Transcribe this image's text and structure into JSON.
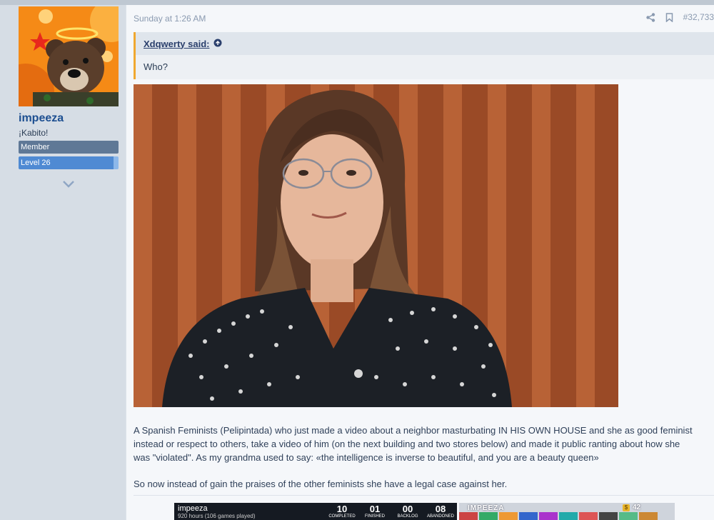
{
  "user": {
    "name": "impeeza",
    "title": "¡Kabito!",
    "banner_member": "Member",
    "banner_level": "Level 26"
  },
  "post": {
    "date": "Sunday at 1:26 AM",
    "number": "#32,733",
    "quote": {
      "author": "Xdqwerty said:",
      "text": "Who?"
    },
    "paragraph1": [
      "A Spanish Feminists (Pelipintada) who just made a video about a neighbor masturbating IN HIS OWN HOUSE and she as good feminist",
      "instead or respect to others, take a video of him (on the next building and two stores below) and made it public ranting about how she",
      "was \"violated\". As my grandma used to say: «the intelligence is inverse to beautiful, and you are a beauty queen»"
    ],
    "paragraph2": "So now instead of gain the praises of the other feminists she have a legal case against her."
  },
  "signature": {
    "card1": {
      "name": "impeeza",
      "hours": "920 hours (106 games played)",
      "stats": [
        {
          "value": "10",
          "label": "COMPLETED"
        },
        {
          "value": "01",
          "label": "FINISHED"
        },
        {
          "value": "00",
          "label": "BACKLOG"
        },
        {
          "value": "08",
          "label": "ABANDONED"
        }
      ]
    },
    "card2": {
      "name": "IMPEEZA",
      "coin": "$",
      "count": "42"
    }
  },
  "icons": {
    "share": "share-icon",
    "bookmark": "bookmark-icon",
    "quote_link": "arrow-up-circle-icon",
    "expand": "chevron-down-icon"
  },
  "colors": {
    "username": "#1d4f91",
    "quote_border": "#f0a830",
    "banner_member": "#5f7896",
    "banner_level": "#4f8ad3"
  }
}
